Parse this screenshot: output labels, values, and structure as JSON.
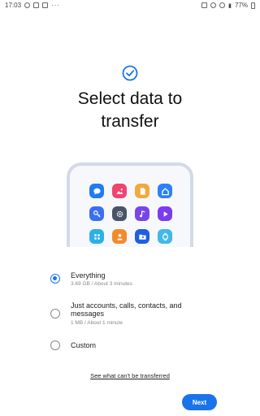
{
  "status_bar": {
    "time": "17:03",
    "left_extra": "···",
    "battery": "77%"
  },
  "header": {
    "title_line1": "Select data to",
    "title_line2": "transfer"
  },
  "illustration": {
    "apps": [
      {
        "icon": "chat-icon",
        "color": "#1f7cf2"
      },
      {
        "icon": "gallery-icon",
        "color": "#f0446f"
      },
      {
        "icon": "file-icon",
        "color": "#f2a93b"
      },
      {
        "icon": "home-icon",
        "color": "#2d7ff9"
      },
      {
        "icon": "key-icon",
        "color": "#3b6ff0"
      },
      {
        "icon": "settings-icon",
        "color": "#4a5368"
      },
      {
        "icon": "music-icon",
        "color": "#7a45e6"
      },
      {
        "icon": "video-icon",
        "color": "#7a3cf0"
      },
      {
        "icon": "apps-icon",
        "color": "#2bb0e8"
      },
      {
        "icon": "contact-icon",
        "color": "#f28a2b"
      },
      {
        "icon": "folder-icon",
        "color": "#1f5fe0"
      },
      {
        "icon": "watch-icon",
        "color": "#41b8e8"
      }
    ]
  },
  "options": [
    {
      "label": "Everything",
      "sub": "3.69 GB / About 3 minutes",
      "checked": true
    },
    {
      "label": "Just accounts, calls, contacts, and messages",
      "sub": "1 MB / About 1 minute",
      "checked": false
    },
    {
      "label": "Custom",
      "sub": "",
      "checked": false
    }
  ],
  "footer": {
    "link": "See what can't be transferred",
    "next": "Next"
  },
  "colors": {
    "accent": "#1a73e8"
  }
}
